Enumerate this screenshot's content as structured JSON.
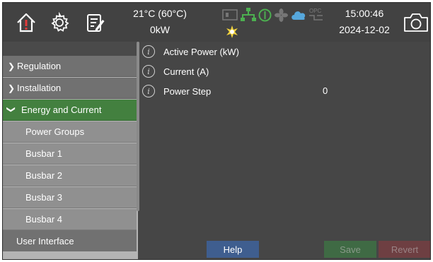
{
  "header": {
    "temperature": "21°C (60°C)",
    "power": "0kW",
    "time": "15:00:46",
    "date": "2024-12-02",
    "opc_label": "OPC"
  },
  "icons": [
    "home-alert-icon",
    "gear-icon",
    "edit-icon",
    "system-status-icons",
    "camera-icon"
  ],
  "sidebar": {
    "items": [
      {
        "label": "Regulation",
        "chevron": ">"
      },
      {
        "label": "Installation",
        "chevron": ">"
      },
      {
        "label": "Energy and Current",
        "chevron": "v"
      }
    ],
    "subitems": [
      "Power Groups",
      "Busbar 1",
      "Busbar 2",
      "Busbar 3",
      "Busbar 4"
    ],
    "bottom_item": "User Interface"
  },
  "main": {
    "rows": [
      {
        "label": "Active Power (kW)",
        "value": ""
      },
      {
        "label": "Current (A)",
        "value": ""
      },
      {
        "label": "Power Step",
        "value": "0"
      }
    ]
  },
  "buttons": {
    "help": "Help",
    "save": "Save",
    "revert": "Revert"
  },
  "colors": {
    "accent_green": "#43803f",
    "help_blue": "#3f5e8f",
    "save_disabled": "#3f6a44",
    "revert_disabled": "#6e3f42",
    "warning_red": "#e23b3b",
    "cloud_blue": "#56a7dc",
    "star_yellow": "#f1d23d"
  }
}
